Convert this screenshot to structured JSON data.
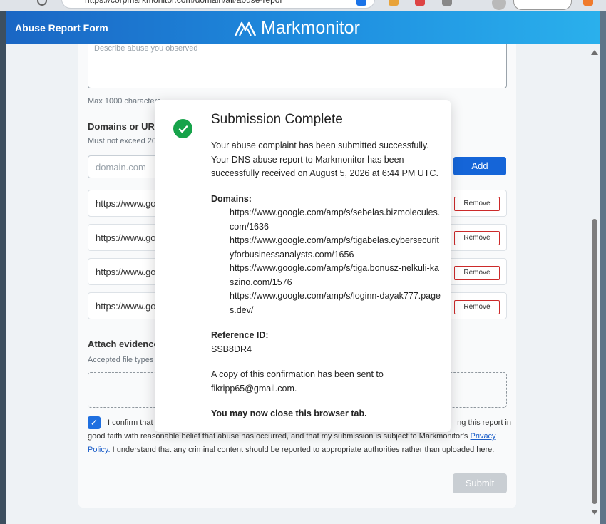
{
  "browser": {
    "url": "https://corpmarkmonitor.com/domain/all/abuse-repor"
  },
  "header": {
    "title": "Abuse Report Form",
    "brand": "Markmonitor"
  },
  "form": {
    "description_placeholder": "Describe abuse you observed",
    "max_chars": "Max 1000 characters",
    "domains_label": "Domains or URLs",
    "domains_hint": "Must not exceed 20",
    "domain_placeholder": "domain.com",
    "add_label": "Add",
    "urls": [
      "https://www.go",
      "https://www.go",
      "https://www.go",
      "https://www.go"
    ],
    "remove_label": "Remove",
    "attach_label": "Attach evidence",
    "accepted_types": "Accepted file types",
    "confirm_part1": "I confirm that",
    "confirm_part1b": "ng this report in",
    "confirm_part2": "good faith with reasonable belief that abuse has occurred, and that my submission is subject to Markmonitor's",
    "privacy_link": "Privacy Policy.",
    "confirm_part3": "I understand that any criminal content should be reported to appropriate authorities rather than uploaded here.",
    "submit_label": "Submit"
  },
  "modal": {
    "title": "Submission Complete",
    "message": "Your abuse complaint has been submitted successfully. Your DNS abuse report to Markmonitor has been successfully received on August 5, 2026 at 6:44 PM UTC.",
    "domains_heading": "Domains:",
    "domains": [
      "https://www.google.com/amp/s/sebelas.bizmolecules.com/1636",
      "https://www.google.com/amp/s/tigabelas.cybersecurityforbusinessanalysts.com/1656",
      "https://www.google.com/amp/s/tiga.bonusz-nelkuli-kaszino.com/1576",
      "https://www.google.com/amp/s/loginn-dayak777.pages.dev/"
    ],
    "reference_heading": "Reference ID:",
    "reference_id": "SSB8DR4",
    "copy_note": "A copy of this confirmation has been sent to fikripp65@gmail.com.",
    "closing": "You may now close this browser tab."
  },
  "colors": {
    "accent": "#1565d8",
    "success": "#16a34a",
    "remove_border": "#cc2a2a"
  }
}
